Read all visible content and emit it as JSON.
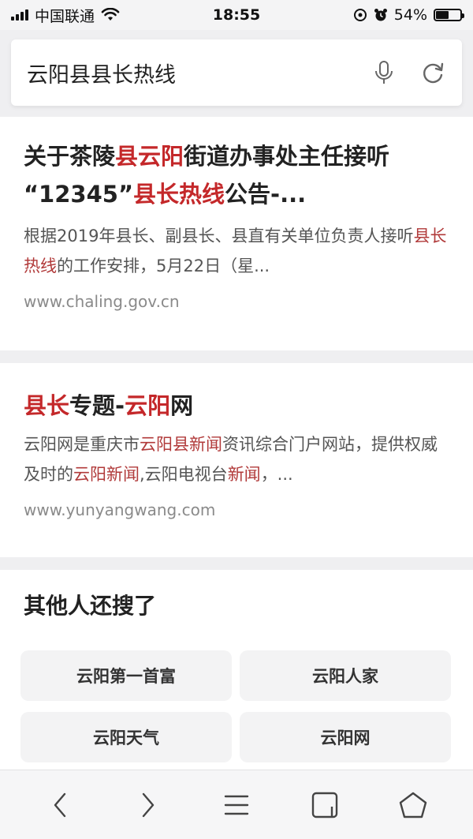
{
  "status_bar": {
    "carrier": "中国联通",
    "time": "18:55",
    "battery": "54%",
    "battery_level": 0.54
  },
  "search": {
    "query": "云阳县县长热线"
  },
  "results": [
    {
      "title_parts": [
        "关于茶陵",
        "县云阳",
        "街道办事处主任接听",
        "“12345”",
        "县长热线",
        "公告-..."
      ],
      "snippet_parts": [
        "根据2019年县长、副县长、县直有关单位负责人接听",
        "县长热线",
        "的工作安排，5月22日（星..."
      ],
      "url": "www.chaling.gov.cn"
    },
    {
      "title_parts": [
        "县长",
        "专题-",
        "云阳",
        "网"
      ],
      "snippet_parts": [
        "云阳网是重庆市",
        "云阳县新闻",
        "资讯综合门户网站，提供权威及时的",
        "云阳新闻",
        ",云阳电视台",
        "新闻",
        "，..."
      ],
      "url": "www.yunyangwang.com"
    }
  ],
  "related": {
    "title": "其他人还搜了",
    "items": [
      "云阳第一首富",
      "云阳人家",
      "云阳天气",
      "云阳网"
    ]
  },
  "colors": {
    "highlight": "#c4282a",
    "background": "#efeff1",
    "card": "#ffffff"
  },
  "icons": {
    "search_bar": [
      "microphone-icon",
      "refresh-icon"
    ],
    "toolbar": [
      "back-icon",
      "forward-icon",
      "menu-icon",
      "tabs-icon",
      "home-icon"
    ]
  }
}
